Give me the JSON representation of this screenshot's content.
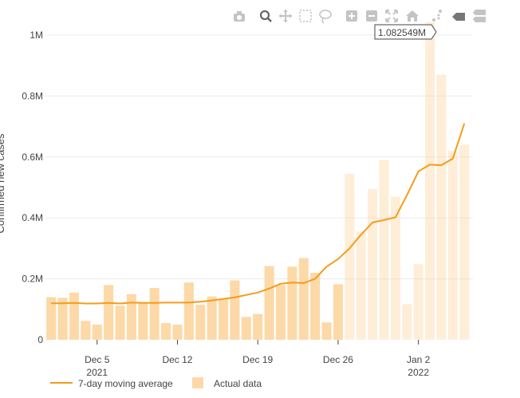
{
  "chart_data": {
    "type": "bar",
    "ylabel": "Confirmed new cases",
    "ylim": [
      0,
      1000000
    ],
    "y_ticks": [
      {
        "value": 0,
        "label": "0"
      },
      {
        "value": 200000,
        "label": "0.2M"
      },
      {
        "value": 400000,
        "label": "0.4M"
      },
      {
        "value": 600000,
        "label": "0.6M"
      },
      {
        "value": 800000,
        "label": "0.8M"
      },
      {
        "value": 1000000,
        "label": "1M"
      }
    ],
    "x_ticks": [
      {
        "date": "2021-12-05",
        "label": "Dec 5",
        "sublabel": "2021"
      },
      {
        "date": "2021-12-12",
        "label": "Dec 12",
        "sublabel": ""
      },
      {
        "date": "2021-12-19",
        "label": "Dec 19",
        "sublabel": ""
      },
      {
        "date": "2021-12-26",
        "label": "Dec 26",
        "sublabel": ""
      },
      {
        "date": "2022-01-02",
        "label": "Jan 2",
        "sublabel": "2022"
      }
    ],
    "x": [
      "2021-12-01",
      "2021-12-02",
      "2021-12-03",
      "2021-12-04",
      "2021-12-05",
      "2021-12-06",
      "2021-12-07",
      "2021-12-08",
      "2021-12-09",
      "2021-12-10",
      "2021-12-11",
      "2021-12-12",
      "2021-12-13",
      "2021-12-14",
      "2021-12-15",
      "2021-12-16",
      "2021-12-17",
      "2021-12-18",
      "2021-12-19",
      "2021-12-20",
      "2021-12-21",
      "2021-12-22",
      "2021-12-23",
      "2021-12-24",
      "2021-12-25",
      "2021-12-26",
      "2021-12-27",
      "2021-12-28",
      "2021-12-29",
      "2021-12-30",
      "2021-12-31",
      "2022-01-01",
      "2022-01-02",
      "2022-01-03",
      "2022-01-04",
      "2022-01-05",
      "2022-01-06"
    ],
    "series": [
      {
        "name": "Actual data",
        "kind": "bar",
        "color": "#fdd9a8",
        "values": [
          140000,
          138000,
          155000,
          62000,
          50000,
          180000,
          112000,
          150000,
          120000,
          170000,
          55000,
          50000,
          188000,
          115000,
          142000,
          135000,
          195000,
          75000,
          85000,
          242000,
          180000,
          240000,
          268000,
          220000,
          57000,
          182000,
          545000,
          355000,
          495000,
          590000,
          470000,
          117000,
          248000,
          1082549,
          870000,
          620000,
          640000
        ]
      },
      {
        "name": "7-day moving average",
        "kind": "line",
        "color": "#f59c1a",
        "values": [
          120000,
          120000,
          121000,
          119000,
          119000,
          121000,
          119000,
          122000,
          121000,
          121000,
          122000,
          122000,
          122000,
          125000,
          129000,
          134000,
          139000,
          147000,
          155000,
          168000,
          184000,
          188000,
          186000,
          200000,
          240000,
          265000,
          300000,
          345000,
          385000,
          393000,
          402000,
          475000,
          553000,
          575000,
          573000,
          595000,
          710000
        ]
      }
    ],
    "tooltip": "1.082549M",
    "legend_position": "bottom"
  },
  "colors": {
    "bar": "#fdd9a8",
    "line": "#f59c1a",
    "grid": "#ececec",
    "modebar": "#c4c4c4",
    "modebar_active": "#666666"
  },
  "modebar": {
    "buttons": [
      "camera-icon",
      "zoom-icon",
      "pan-icon",
      "box-select-icon",
      "lasso-select-icon",
      "zoom-in-icon",
      "zoom-out-icon",
      "autoscale-icon",
      "reset-axes-icon",
      "spike-lines-icon",
      "hover-closest-icon",
      "hover-compare-icon"
    ]
  }
}
